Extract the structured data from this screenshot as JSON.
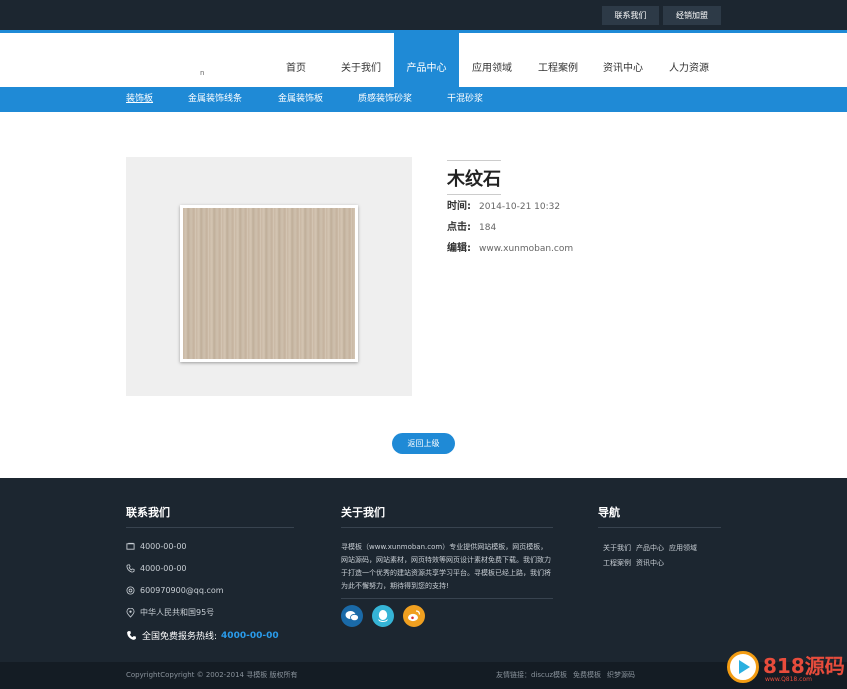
{
  "topbar": {
    "contact": "联系我们",
    "dealer": "经销加盟"
  },
  "logo": {
    "fragment": "n"
  },
  "nav": [
    {
      "label": "首页"
    },
    {
      "label": "关于我们"
    },
    {
      "label": "产品中心",
      "active": true
    },
    {
      "label": "应用领域"
    },
    {
      "label": "工程案例"
    },
    {
      "label": "资讯中心"
    },
    {
      "label": "人力资源"
    }
  ],
  "subnav": [
    {
      "label": "装饰板",
      "active": true
    },
    {
      "label": "金属装饰线条"
    },
    {
      "label": "金属装饰板"
    },
    {
      "label": "质感装饰砂浆"
    },
    {
      "label": "干混砂浆"
    }
  ],
  "product": {
    "title": "木纹石",
    "time_label": "时间:",
    "time": "2014-10-21 10:32",
    "hits_label": "点击:",
    "hits": "184",
    "editor_label": "编辑:",
    "editor": "www.xunmoban.com"
  },
  "back_button": "返回上级",
  "footer": {
    "contact_title": "联系我们",
    "phone1": "4000-00-00",
    "phone2": "4000-00-00",
    "email": "600970900@qq.com",
    "address": "中华人民共和国95号",
    "hotline_label": "全国免费报务热线:",
    "hotline": "4000-00-00",
    "about_title": "关于我们",
    "about_text": "寻模板（www.xunmoban.com）专业提供网站模板，网页模板，网站源码，网站素材，网页特效等网页设计素材免费下载。我们致力于打造一个优秀的建站资源共享学习平台。寻模板已经上路，我们将为此不懈努力，期待得到您的支持!",
    "nav_title": "导航",
    "nav_links": [
      "关于我们",
      "产品中心",
      "应用领域",
      "工程案例",
      "资讯中心"
    ],
    "copyright": "CopyrightCopyright © 2002-2014 寻模板 版权所有",
    "friend_label": "友情链接：",
    "friend_links": [
      "discuz模板",
      "免费模板",
      "织梦源码"
    ]
  },
  "watermark": {
    "brand": "818源码",
    "url": "www.Q818.com"
  },
  "colors": {
    "accent": "#1f8ad6",
    "dark": "#1c2630",
    "wechat": "#1a6aa8",
    "qq": "#35b4d6",
    "weibo": "#f0a020"
  }
}
